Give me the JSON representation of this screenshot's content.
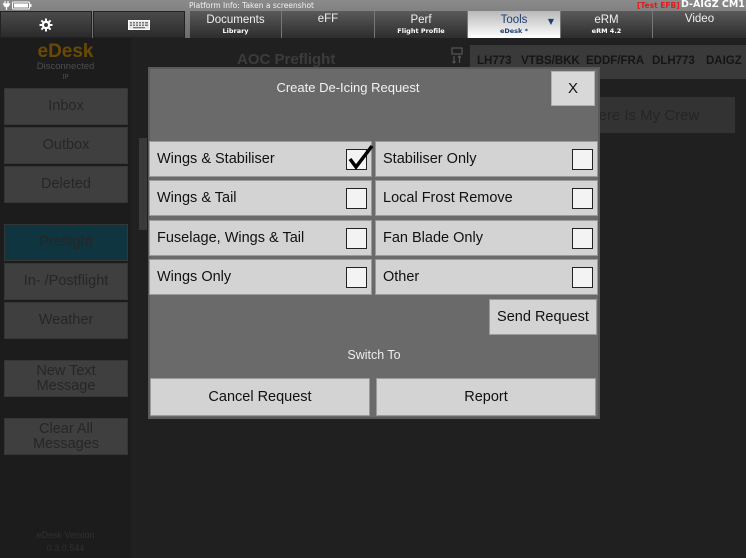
{
  "status_bar": {
    "platform_info": "Platform Info: Taken a screenshot",
    "test_badge": "[Test EFB]",
    "device_id": "D-AIGZ CM1"
  },
  "toolbar": {
    "settings_icon": "gear-icon",
    "keyboard_icon": "keyboard-icon",
    "tabs": [
      {
        "label": "Documents",
        "sub": "Library",
        "active": false
      },
      {
        "label": "eFF",
        "sub": "",
        "active": false
      },
      {
        "label": "Perf",
        "sub": "Flight Profile",
        "active": false
      },
      {
        "label": "Tools",
        "sub": "eDesk *",
        "active": true,
        "dropdown": "▼"
      },
      {
        "label": "eRM",
        "sub": "eRM 4.2",
        "active": false
      },
      {
        "label": "Video",
        "sub": "",
        "active": false
      }
    ]
  },
  "sidebar": {
    "logo": "eDesk",
    "connection_status": "Disconnected",
    "connection_ip": "IP",
    "items": [
      {
        "label": "Inbox"
      },
      {
        "label": "Outbox"
      },
      {
        "label": "Deleted"
      },
      {
        "label": "Preflight",
        "active": true
      },
      {
        "label": "In- /Postflight"
      },
      {
        "label": "Weather"
      },
      {
        "label": "New Text Message"
      },
      {
        "label": "Clear All Messages"
      }
    ],
    "version_label": "eDesk Version",
    "version_number": "0.3.0.544"
  },
  "main": {
    "title": "AOC Preflight",
    "flight_info": [
      "LH773",
      "VTBS/BKK",
      "EDDF/FRA",
      "DLH773",
      "DAIGZ"
    ],
    "crew_button": "Where Is My Crew",
    "colors": {
      "accent_active": "#0f3540",
      "logo": "#6b4a00",
      "test_badge": "#e21a1a"
    }
  },
  "dialog": {
    "title": "Create De-Icing Request",
    "close_label": "X",
    "options": [
      {
        "label": "Wings & Stabiliser",
        "checked": true
      },
      {
        "label": "Stabiliser Only",
        "checked": false
      },
      {
        "label": "Wings & Tail",
        "checked": false
      },
      {
        "label": "Local Frost Remove",
        "checked": false
      },
      {
        "label": "Fuselage, Wings & Tail",
        "checked": false
      },
      {
        "label": "Fan Blade Only",
        "checked": false
      },
      {
        "label": "Wings Only",
        "checked": false
      },
      {
        "label": "Other",
        "checked": false
      }
    ],
    "send_label": "Send Request",
    "switch_label": "Switch To",
    "cancel_label": "Cancel Request",
    "report_label": "Report"
  }
}
